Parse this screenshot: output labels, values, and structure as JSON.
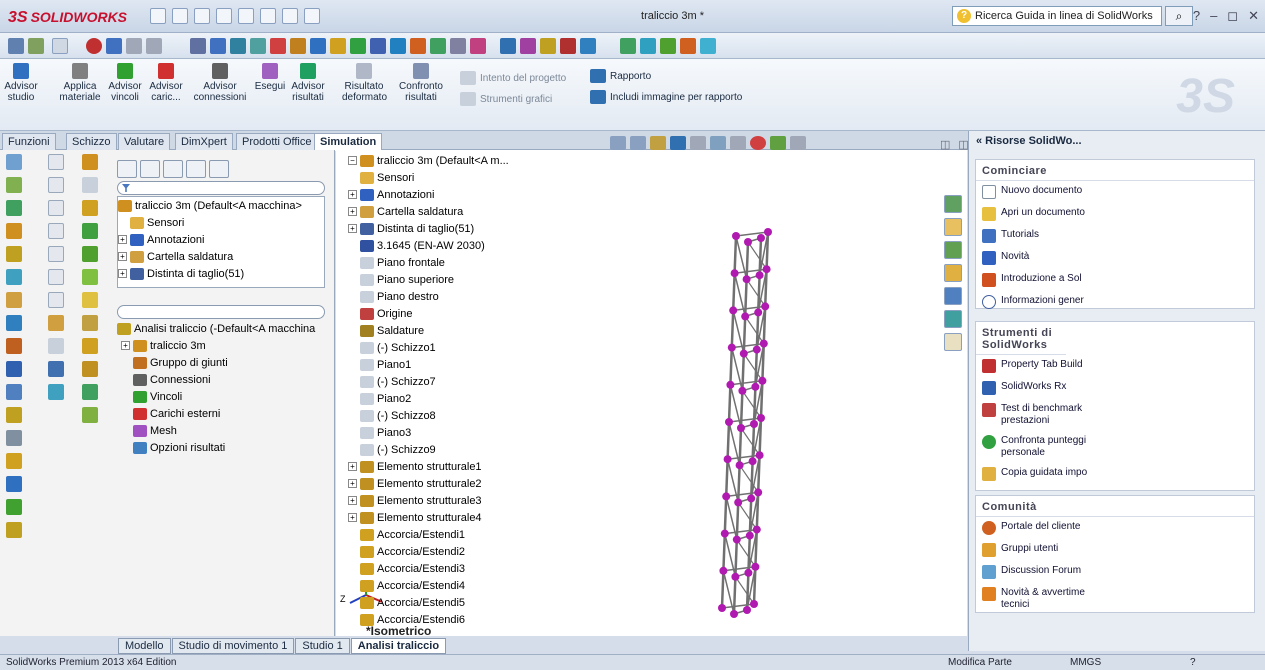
{
  "app": {
    "brand": "SOLIDWORKS",
    "brand_prefix": "3S",
    "document_title": "traliccio 3m *",
    "help_search_placeholder": "Ricerca Guida in linea di SolidWorks"
  },
  "ribbon": {
    "buttons": [
      {
        "label": "Advisor studio",
        "color": "#3070c0"
      },
      {
        "label": "Applica materiale",
        "color": "#808080"
      },
      {
        "label": "Advisor vincoli",
        "color": "#30a030"
      },
      {
        "label": "Advisor caric...",
        "color": "#d03030"
      },
      {
        "label": "Advisor connessioni",
        "color": "#606060"
      },
      {
        "label": "Esegui",
        "color": "#a060c0"
      },
      {
        "label": "Advisor risultati",
        "color": "#20a060"
      },
      {
        "label": "Risultato deformato",
        "color": "#b0b8c8"
      },
      {
        "label": "Confronto risultati",
        "color": "#8090b0"
      }
    ],
    "design_intent": "Intento del progetto",
    "graphic_tools": "Strumenti grafici",
    "report": "Rapporto",
    "include_image": "Includi immagine per rapporto"
  },
  "command_tabs": [
    "Funzioni",
    "Schizzo",
    "Valutare",
    "DimXpert",
    "Prodotti Office",
    "Simulation"
  ],
  "feature_tree": [
    {
      "label": "traliccio 3m  (Default<A macchina>",
      "icon": "part-icon",
      "color": "#d09020"
    },
    {
      "label": "Sensori",
      "icon": "sensor-icon",
      "color": "#e0b040"
    },
    {
      "label": "Annotazioni",
      "icon": "annotation-icon",
      "color": "#3060c0"
    },
    {
      "label": "Cartella saldatura",
      "icon": "folder-icon",
      "color": "#d0a040"
    },
    {
      "label": "Distinta di taglio(51)",
      "icon": "cutlist-icon",
      "color": "#4060a0"
    }
  ],
  "sim_tree": [
    {
      "label": "Analisi traliccio (-Default<A macchina",
      "color": "#c0a020"
    },
    {
      "label": "traliccio 3m",
      "color": "#d09020"
    },
    {
      "label": "Gruppo di giunti",
      "color": "#c07020"
    },
    {
      "label": "Connessioni",
      "color": "#606060"
    },
    {
      "label": "Vincoli",
      "color": "#30a030"
    },
    {
      "label": "Carichi esterni",
      "color": "#d03030"
    },
    {
      "label": "Mesh",
      "color": "#a050c0"
    },
    {
      "label": "Opzioni risultati",
      "color": "#4080c0"
    }
  ],
  "view_tree": [
    {
      "label": "traliccio 3m  (Default<A m...",
      "color": "#d09020"
    },
    {
      "label": "Sensori",
      "color": "#e0b040"
    },
    {
      "label": "Annotazioni",
      "color": "#3060c0"
    },
    {
      "label": "Cartella saldatura",
      "color": "#d0a040"
    },
    {
      "label": "Distinta di taglio(51)",
      "color": "#4060a0"
    },
    {
      "label": "3.1645 (EN-AW 2030)",
      "color": "#3050a0"
    },
    {
      "label": "Piano frontale",
      "color": "#9090a0"
    },
    {
      "label": "Piano superiore",
      "color": "#9090a0"
    },
    {
      "label": "Piano destro",
      "color": "#9090a0"
    },
    {
      "label": "Origine",
      "color": "#c04040"
    },
    {
      "label": "Saldature",
      "color": "#a08020"
    },
    {
      "label": "(-) Schizzo1",
      "color": "#8090a0"
    },
    {
      "label": "Piano1",
      "color": "#9090a0"
    },
    {
      "label": "(-) Schizzo7",
      "color": "#8090a0"
    },
    {
      "label": "Piano2",
      "color": "#9090a0"
    },
    {
      "label": "(-) Schizzo8",
      "color": "#8090a0"
    },
    {
      "label": "Piano3",
      "color": "#9090a0"
    },
    {
      "label": "(-) Schizzo9",
      "color": "#8090a0"
    },
    {
      "label": "Elemento strutturale1",
      "color": "#c09020"
    },
    {
      "label": "Elemento strutturale2",
      "color": "#c09020"
    },
    {
      "label": "Elemento strutturale3",
      "color": "#c09020"
    },
    {
      "label": "Elemento strutturale4",
      "color": "#c09020"
    },
    {
      "label": "Accorcia/Estendi1",
      "color": "#d0a020"
    },
    {
      "label": "Accorcia/Estendi2",
      "color": "#d0a020"
    },
    {
      "label": "Accorcia/Estendi3",
      "color": "#d0a020"
    },
    {
      "label": "Accorcia/Estendi4",
      "color": "#d0a020"
    },
    {
      "label": "Accorcia/Estendi5",
      "color": "#d0a020"
    },
    {
      "label": "Accorcia/Estendi6",
      "color": "#d0a020"
    }
  ],
  "view_label": "*Isometrico",
  "right_panel": {
    "title": "« Risorse SolidWo...",
    "start": {
      "heading": "Cominciare",
      "items": [
        "Nuovo documento",
        "Apri un documento",
        "Tutorials",
        "Novità",
        "Introduzione a Sol",
        "Informazioni gener"
      ]
    },
    "tools": {
      "heading": "Strumenti di SolidWorks",
      "items": [
        "Property Tab Build",
        "SolidWorks Rx",
        "Test di benchmark prestazioni",
        "Confronta punteggi personale",
        "Copia guidata impo"
      ]
    },
    "community": {
      "heading": "Comunità",
      "items": [
        "Portale del cliente",
        "Gruppi utenti",
        "Discussion Forum",
        "Novità & avvertime tecnici"
      ]
    }
  },
  "bottom_tabs": [
    "Modello",
    "Studio di movimento 1",
    "Studio 1",
    "Analisi traliccio"
  ],
  "status": {
    "edition": "SolidWorks Premium 2013 x64 Edition",
    "mode": "Modifica Parte",
    "units": "MMGS"
  },
  "colors": {
    "brand": "#c8102e",
    "node": "#b01ab0",
    "frame": "#707070"
  }
}
